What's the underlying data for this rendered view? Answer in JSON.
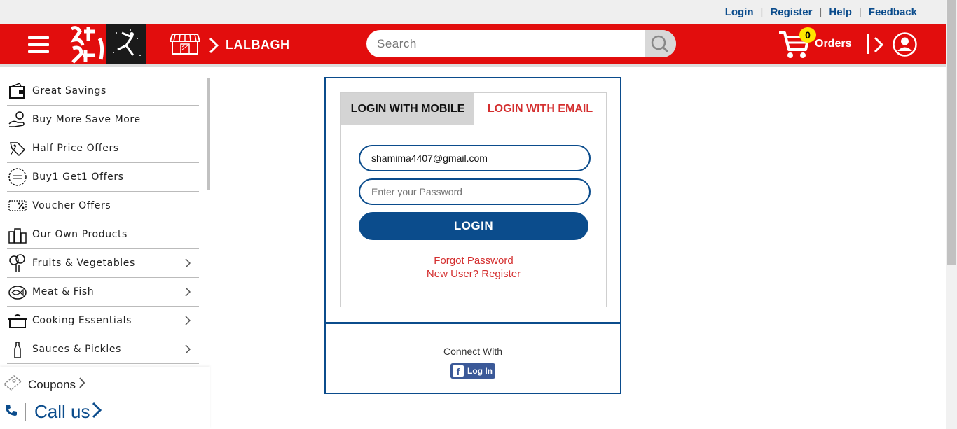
{
  "top_links": {
    "login": "Login",
    "register": "Register",
    "help": "Help",
    "feedback": "Feedback",
    "separator": "|"
  },
  "header": {
    "store_name": "LALBAGH",
    "search_placeholder": "Search",
    "cart_count": "0",
    "orders_label": "Orders",
    "brand_color": "#e20d0d",
    "accent_color": "#0b4c8c"
  },
  "sidebar": {
    "items": [
      {
        "label": "Great Savings",
        "icon": "wallet-icon",
        "has_arrow": false
      },
      {
        "label": "Buy More Save More",
        "icon": "hand-coin-icon",
        "has_arrow": false
      },
      {
        "label": "Half Price Offers",
        "icon": "tag-icon",
        "has_arrow": false
      },
      {
        "label": "Buy1 Get1 Offers",
        "icon": "badge-icon",
        "has_arrow": false
      },
      {
        "label": "Voucher Offers",
        "icon": "voucher-icon",
        "has_arrow": false
      },
      {
        "label": "Our Own Products",
        "icon": "jars-icon",
        "has_arrow": false
      },
      {
        "label": "Fruits & Vegetables",
        "icon": "broccoli-icon",
        "has_arrow": true
      },
      {
        "label": "Meat & Fish",
        "icon": "fish-icon",
        "has_arrow": true
      },
      {
        "label": "Cooking Essentials",
        "icon": "pot-icon",
        "has_arrow": true
      },
      {
        "label": "Sauces & Pickles",
        "icon": "bottle-icon",
        "has_arrow": true
      }
    ],
    "coupons_label": "Coupons",
    "callus_label": "Call us"
  },
  "login": {
    "tab_mobile": "LOGIN WITH MOBILE",
    "tab_email": "LOGIN WITH EMAIL",
    "email_value": "shamima4407@gmail.com",
    "password_placeholder": "Enter your Password",
    "login_button": "LOGIN",
    "forgot_password": "Forgot Password",
    "new_user": "New User? Register",
    "connect_with": "Connect With",
    "fb_login": "Log In",
    "fb_letter": "f"
  }
}
